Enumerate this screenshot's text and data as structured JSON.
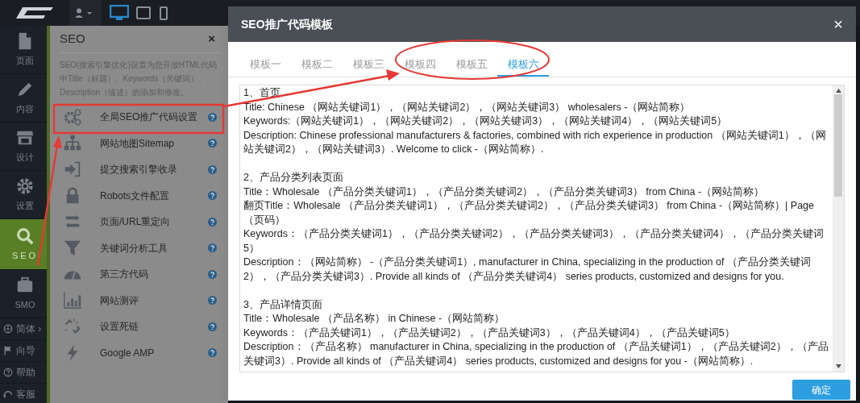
{
  "rail": {
    "items": [
      {
        "label": "页面",
        "selected": false
      },
      {
        "label": "内容",
        "selected": false
      },
      {
        "label": "设计",
        "selected": false
      },
      {
        "label": "设置",
        "selected": false
      },
      {
        "label": "SEO",
        "selected": true
      },
      {
        "label": "SMO",
        "selected": false
      }
    ],
    "links": [
      "简体 ›",
      "向导",
      "帮助",
      "客服"
    ]
  },
  "panel": {
    "title": "SEO",
    "close": "×",
    "description": "SEO(搜索引擎优化)设置为您开放HTML代码中Title（标题）、Keywords（关键词）、Description（描述）的添加和修改。",
    "items": [
      "全局SEO推广代码设置",
      "网站地图Sitemap",
      "提交搜索引擎收录",
      "Robots文件配置",
      "页面/URL重定向",
      "关键词分析工具",
      "第三方代码",
      "网站测评",
      "设置死链",
      "Google AMP"
    ]
  },
  "dialog": {
    "title": "SEO推广代码模板",
    "close": "×",
    "tabs": [
      {
        "label": "模板一",
        "selected": false
      },
      {
        "label": "模板二",
        "selected": false
      },
      {
        "label": "模板三",
        "selected": false
      },
      {
        "label": "模板四",
        "selected": false
      },
      {
        "label": "模板五",
        "selected": false
      },
      {
        "label": "模板六",
        "selected": true
      }
    ],
    "sections": [
      {
        "heading": "1、首页",
        "lines": [
          "Title: Chinese （网站关键词1），（网站关键词2），（网站关键词3） wholesalers -（网站简称）",
          "Keywords:（网站关键词1），（网站关键词2），（网站关键词3），（网站关键词4），（网站关键词5）",
          "Description: Chinese professional manufacturers & factories, combined with rich experience in production （网站关键词1），（网站关键词2），（网站关键词3）. Welcome to click -（网站简称）."
        ]
      },
      {
        "heading": "2、产品分类列表页面",
        "lines": [
          "Title：Wholesale （产品分类关键词1），（产品分类关键词2），（产品分类关键词3） from China -（网站简称）",
          "翻页Title：Wholesale （产品分类关键词1），（产品分类关键词2），（产品分类关键词3） from China -（网站简称）| Page （页码）",
          "Keywords：（产品分类关键词1），（产品分类关键词2），（产品分类关键词3），（产品分类关键词4），（产品分类关键词5）",
          "Description：（网站简称） -（产品分类关键词1）, manufacturer in China, specializing in the production of （产品分类关键词2），（产品分类关键词3）. Provide all kinds of （产品分类关键词4） series products, customized and designs for you."
        ]
      },
      {
        "heading": "3、产品详情页面",
        "lines": [
          "Title：Wholesale （产品名称） in Chinese -（网站简称）",
          "Keywords：（产品关键词1），（产品关键词2），（产品关键词3），（产品关键词4），（产品关键词5）",
          "Description：（产品名称） manufacturer in China, specializing in the production of （产品关键词1），（产品关键词2），（产品关键词3）. Provide all kinds of （产品关键词4） series products, customized and designs for you -（网站简称）."
        ]
      }
    ],
    "ok_button": "确定"
  }
}
